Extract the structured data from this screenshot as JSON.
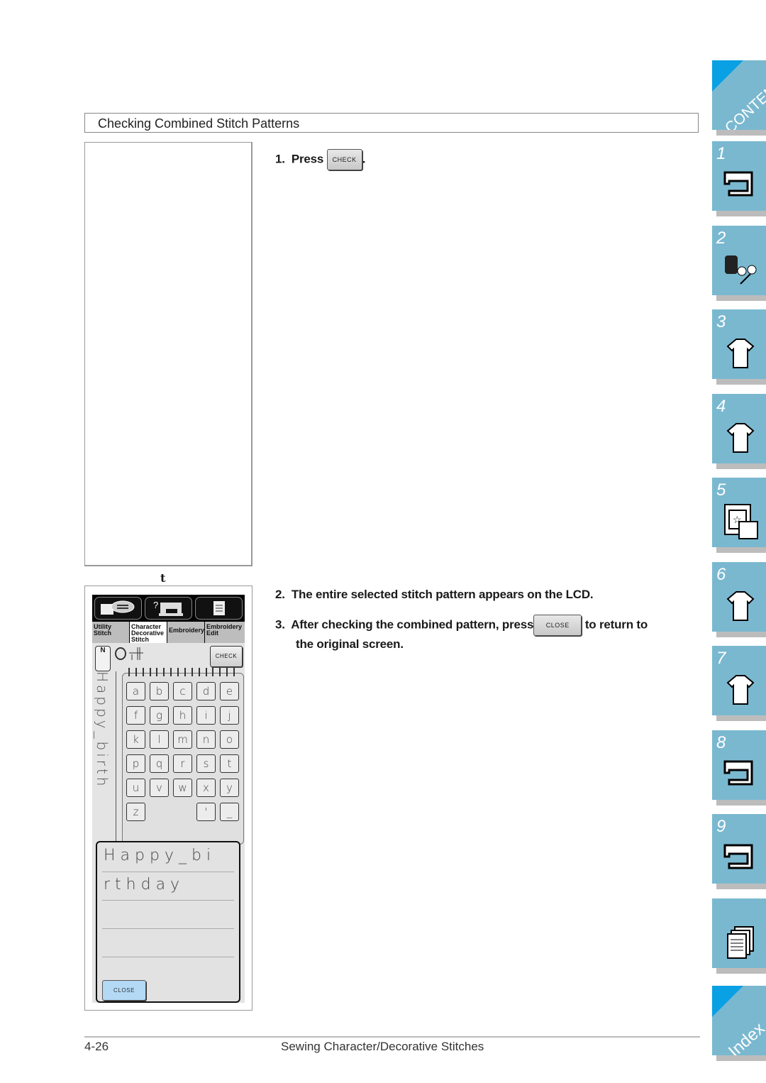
{
  "section": {
    "title": "Checking Combined Stitch Patterns"
  },
  "figure_caption": "t",
  "steps": [
    {
      "num": "1.",
      "text_before": "Press",
      "button": "CHECK",
      "text_after": "."
    },
    {
      "num": "2.",
      "text": "The entire selected stitch pattern appears on the LCD."
    },
    {
      "num": "3.",
      "text_before": "After checking the combined pattern, press",
      "button": "CLOSE",
      "text_after": "to return to",
      "text_line2": "the original screen."
    }
  ],
  "lcd": {
    "tabs": [
      {
        "line1": "Utility",
        "line2": "Stitch",
        "line3": ""
      },
      {
        "line1": "Character",
        "line2": "Decorative",
        "line3": "Stitch"
      },
      {
        "line1": "Embroidery",
        "line2": "",
        "line3": ""
      },
      {
        "line1": "Embroidery",
        "line2": "Edit",
        "line3": ""
      }
    ],
    "active_tab": 1,
    "foot_label": "N",
    "check_button": "CHECK",
    "vertical_text": "Happy_birth",
    "keys": [
      "a",
      "b",
      "c",
      "d",
      "e",
      "f",
      "g",
      "h",
      "i",
      "j",
      "k",
      "l",
      "m",
      "n",
      "o",
      "p",
      "q",
      "r",
      "s",
      "t",
      "u",
      "v",
      "w",
      "x",
      "y",
      "z",
      "'",
      "_"
    ],
    "popup": {
      "line1": "Happy_bi",
      "line2": "rthday",
      "close_button": "CLOSE"
    }
  },
  "footer": {
    "page": "4-26",
    "title": "Sewing Character/Decorative Stitches"
  },
  "side_nav": {
    "contents_label": "CONTENTS",
    "index_label": "Index",
    "chapters": [
      "1",
      "2",
      "3",
      "4",
      "5",
      "6",
      "7",
      "8",
      "9",
      ""
    ],
    "colors": {
      "tab": "#7ab8d0",
      "corner": "#0aa0e4",
      "shadow": "#bcbcbc"
    }
  }
}
